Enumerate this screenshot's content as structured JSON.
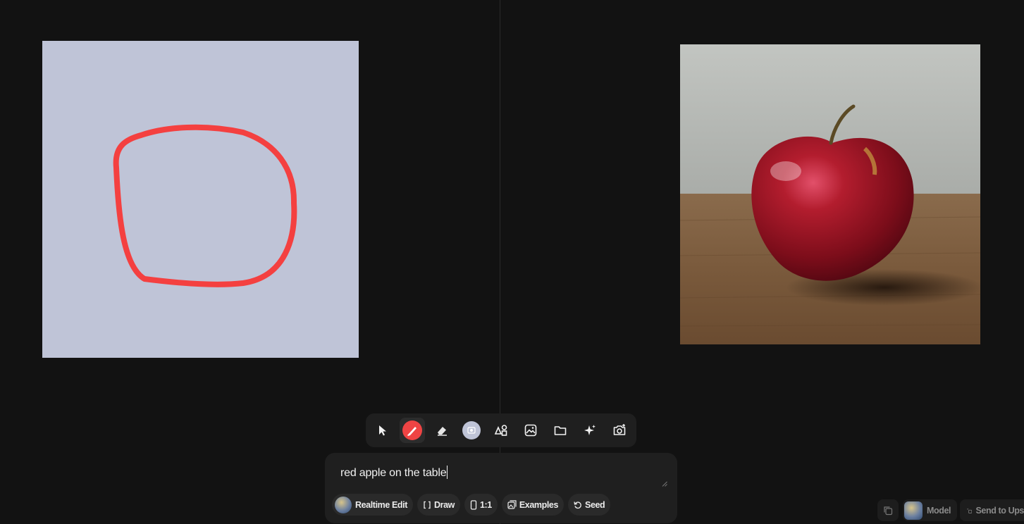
{
  "prompt": {
    "text": "red apple on the table"
  },
  "toolbar": {
    "tools": [
      "select-icon",
      "brush-icon",
      "eraser-icon",
      "color-swatch",
      "shapes-icon",
      "image-icon",
      "folder-icon",
      "sparkles-icon",
      "camera-icon"
    ],
    "active": "brush-icon",
    "brush_color": "#ef4444",
    "swatch_color": "#bfc4d7"
  },
  "chips": {
    "realtime_edit": "Realtime Edit",
    "draw": "Draw",
    "ratio": "1:1",
    "examples": "Examples",
    "seed": "Seed"
  },
  "bottom_right": {
    "model": "Model",
    "send": "Send to Ups"
  },
  "colors": {
    "background": "#121212",
    "canvas": "#bfc4d7",
    "stroke": "#f44040",
    "panel": "#1f1f1f"
  }
}
